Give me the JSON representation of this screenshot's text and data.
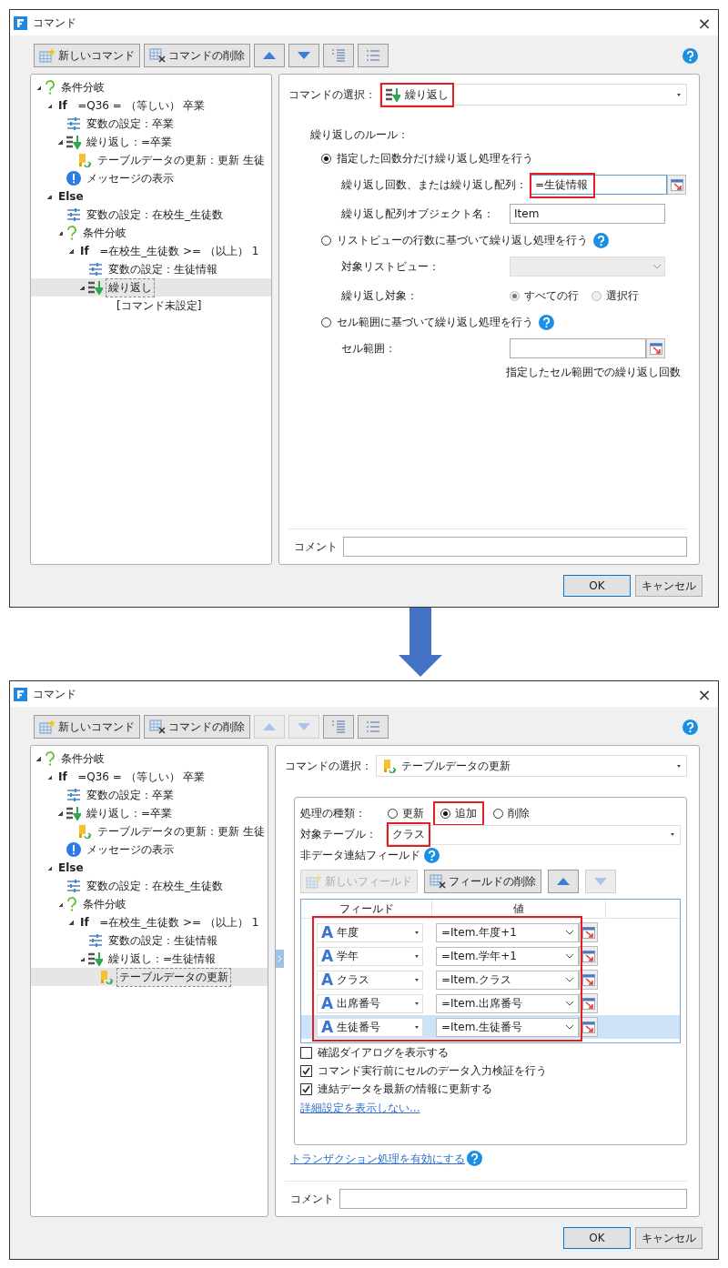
{
  "dialogs": [
    {
      "title": "コマンド",
      "close": "×",
      "toolbar": [
        {
          "kind": "new",
          "label": "新しいコマンド",
          "disabled": false
        },
        {
          "kind": "delete",
          "label": "コマンドの削除",
          "disabled": false
        },
        {
          "kind": "up",
          "disabled": false
        },
        {
          "kind": "down",
          "disabled": false
        },
        {
          "kind": "indent",
          "disabled": false
        },
        {
          "kind": "outdent",
          "disabled": false
        }
      ],
      "tree": [
        {
          "kind": "condition",
          "label": "条件分岐",
          "expanded": true,
          "selected": false,
          "children": [
            {
              "kind": "if",
              "label": "**If**   =Q36 = （等しい） 卒業",
              "expanded": true,
              "selected": false,
              "children": [
                {
                  "kind": "variable",
                  "label": "変数の設定：卒業",
                  "selected": false
                },
                {
                  "kind": "repeat",
                  "label": "繰り返し：=卒業",
                  "expanded": true,
                  "selected": false,
                  "children": [
                    {
                      "kind": "table",
                      "label": "テーブルデータの更新：更新 生徒",
                      "selected": false
                    }
                  ]
                },
                {
                  "kind": "message",
                  "label": "メッセージの表示",
                  "selected": false
                }
              ]
            },
            {
              "kind": "else",
              "label": "Else",
              "expanded": true,
              "selected": false,
              "children": [
                {
                  "kind": "variable",
                  "label": "変数の設定：在校生_生徒数",
                  "selected": false
                },
                {
                  "kind": "condition",
                  "label": "条件分岐",
                  "expanded": true,
                  "selected": false,
                  "children": [
                    {
                      "kind": "if",
                      "label": "**If**   =在校生_生徒数 >= （以上） 1",
                      "expanded": true,
                      "selected": false,
                      "children": [
                        {
                          "kind": "variable",
                          "label": "変数の設定：生徒情報",
                          "selected": false
                        },
                        {
                          "kind": "repeat",
                          "label": "繰り返し",
                          "expanded": true,
                          "selected": true,
                          "children": [
                            {
                              "kind": "none",
                              "label": "[コマンド未設定]",
                              "selected": false
                            }
                          ]
                        }
                      ]
                    }
                  ]
                }
              ]
            }
          ]
        }
      ],
      "panel": {
        "kind": "repeat",
        "command": {
          "label": "コマンドの選択：",
          "kind": "repeat",
          "value": "繰り返し",
          "highlight": true
        },
        "rule_label": "繰り返しのルール：",
        "options": [
          {
            "label": "指定した回数分だけ繰り返し処理を行う",
            "selected": true,
            "fields": [
              {
                "kind": "picker",
                "label": "繰り返し回数、または繰り返し配列：",
                "value": "=生徒情報",
                "highlight": true,
                "focused": true
              },
              {
                "kind": "text",
                "label": "繰り返し配列オブジェクト名：",
                "value": "Item",
                "focused": false
              }
            ]
          },
          {
            "label": "リストビューの行数に基づいて繰り返し処理を行う",
            "selected": false,
            "help": true,
            "fields": [
              {
                "kind": "select",
                "label": "対象リストビュー：",
                "disabled": true
              },
              {
                "kind": "radios",
                "label": "繰り返し対象：",
                "choices": [
                  {
                    "label": "すべての行",
                    "selected": true
                  },
                  {
                    "label": "選択行",
                    "selected": false
                  }
                ]
              }
            ]
          },
          {
            "label": "セル範囲に基づいて繰り返し処理を行う",
            "selected": false,
            "help": true,
            "fields": [
              {
                "kind": "picker",
                "label": "セル範囲：",
                "focused": false
              }
            ],
            "note": "指定したセル範囲での繰り返し回数"
          }
        ],
        "comment_label": "コメント"
      },
      "buttons": [
        {
          "label": "OK",
          "default": true
        },
        {
          "label": "キャンセル",
          "default": false
        }
      ]
    },
    {
      "title": "コマンド",
      "close": "×",
      "toolbar": [
        {
          "kind": "new",
          "label": "新しいコマンド",
          "disabled": false
        },
        {
          "kind": "delete",
          "label": "コマンドの削除",
          "disabled": false
        },
        {
          "kind": "up",
          "disabled": true
        },
        {
          "kind": "down",
          "disabled": true
        },
        {
          "kind": "indent",
          "disabled": false
        },
        {
          "kind": "outdent",
          "disabled": false
        }
      ],
      "tree": [
        {
          "kind": "condition",
          "label": "条件分岐",
          "expanded": true,
          "selected": false,
          "children": [
            {
              "kind": "if",
              "label": "**If**   =Q36 = （等しい） 卒業",
              "expanded": true,
              "selected": false,
              "children": [
                {
                  "kind": "variable",
                  "label": "変数の設定：卒業",
                  "selected": false
                },
                {
                  "kind": "repeat",
                  "label": "繰り返し：=卒業",
                  "expanded": true,
                  "selected": false,
                  "children": [
                    {
                      "kind": "table",
                      "label": "テーブルデータの更新：更新 生徒",
                      "selected": false
                    }
                  ]
                },
                {
                  "kind": "message",
                  "label": "メッセージの表示",
                  "selected": false
                }
              ]
            },
            {
              "kind": "else",
              "label": "Else",
              "expanded": true,
              "selected": false,
              "children": [
                {
                  "kind": "variable",
                  "label": "変数の設定：在校生_生徒数",
                  "selected": false
                },
                {
                  "kind": "condition",
                  "label": "条件分岐",
                  "expanded": true,
                  "selected": false,
                  "children": [
                    {
                      "kind": "if",
                      "label": "**If**   =在校生_生徒数 >= （以上） 1",
                      "expanded": true,
                      "selected": false,
                      "children": [
                        {
                          "kind": "variable",
                          "label": "変数の設定：生徒情報",
                          "selected": false
                        },
                        {
                          "kind": "repeat",
                          "label": "繰り返し：=生徒情報",
                          "expanded": true,
                          "selected": false,
                          "children": [
                            {
                              "kind": "table",
                              "label": "テーブルデータの更新",
                              "selected": true
                            }
                          ]
                        }
                      ]
                    }
                  ]
                }
              ]
            }
          ]
        }
      ],
      "panel": {
        "kind": "table_update",
        "command": {
          "label": "コマンドの選択：",
          "kind": "table",
          "value": "テーブルデータの更新"
        },
        "operation": {
          "label": "処理の種類：",
          "choices": [
            {
              "label": "更新",
              "selected": false
            },
            {
              "label": "追加",
              "selected": true,
              "highlight": true
            },
            {
              "label": "削除",
              "selected": false
            }
          ]
        },
        "target": {
          "label": "対象テーブル：",
          "value": "クラス",
          "highlight": true
        },
        "fields_label": "非データ連結フィールド",
        "field_toolbar": [
          {
            "kind": "new",
            "label": "新しいフィールド",
            "disabled": true
          },
          {
            "kind": "delete",
            "label": "フィールドの削除",
            "disabled": false
          },
          {
            "kind": "up",
            "disabled": false
          },
          {
            "kind": "down",
            "disabled": true
          }
        ],
        "table": {
          "columns": [
            "フィールド",
            "値"
          ],
          "highlight": true,
          "rows": [
            {
              "type": "A",
              "field": "年度",
              "value": "=Item.年度+1",
              "selected": false
            },
            {
              "type": "A",
              "field": "学年",
              "value": "=Item.学年+1",
              "selected": false
            },
            {
              "type": "A",
              "field": "クラス",
              "value": "=Item.クラス",
              "selected": false
            },
            {
              "type": "A",
              "field": "出席番号",
              "value": "=Item.出席番号",
              "selected": false
            },
            {
              "type": "A",
              "field": "生徒番号",
              "value": "=Item.生徒番号",
              "selected": true
            }
          ]
        },
        "checkboxes": [
          {
            "label": "確認ダイアログを表示する",
            "checked": false
          },
          {
            "label": "コマンド実行前にセルのデータ入力検証を行う",
            "checked": true
          },
          {
            "label": "連結データを最新の情報に更新する",
            "checked": true
          }
        ],
        "details_link": "詳細設定を表示しない...",
        "transaction_link": "トランザクション処理を有効にする",
        "comment_label": "コメント"
      },
      "buttons": [
        {
          "label": "OK",
          "default": true
        },
        {
          "label": "キャンセル",
          "default": false
        }
      ]
    }
  ]
}
